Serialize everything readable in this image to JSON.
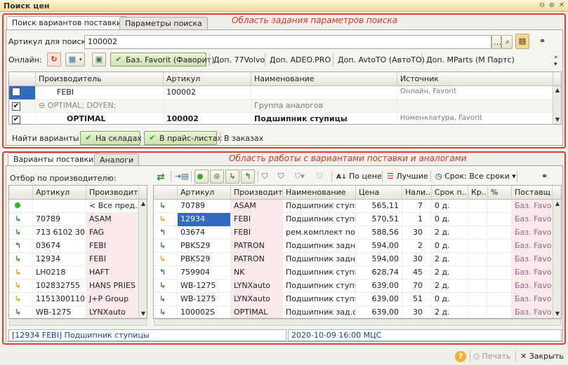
{
  "window": {
    "title": "Поиск цен"
  },
  "top_panel": {
    "label": "Область задания параметров поиска",
    "tabs": [
      "Поиск вариантов поставки",
      "Параметры поиска"
    ],
    "article_label": "Артикул для поиска:",
    "article_value": "100002",
    "online_label": "Онлайн:",
    "sources": [
      "Баз. Favorit (Фаворит)",
      "Доп. 77Volvo",
      "Доп. ADEO.PRO",
      "Доп. AvtoTO (АвтоТО)",
      "Доп. MParts (М Партс)"
    ],
    "grid": {
      "columns": [
        "Производитель",
        "Артикул",
        "Наименование",
        "Источник"
      ],
      "rows": [
        {
          "checked": false,
          "maker": "FEBI",
          "article": "100002",
          "name": "",
          "source": "Онлайн, Favorit"
        },
        {
          "checked": true,
          "maker": "OPTIMAL; DOYEN;",
          "article": "",
          "name": "Группа аналогов",
          "source": ""
        },
        {
          "checked": true,
          "maker": "OPTIMAL",
          "article": "100002",
          "name": "Подшипник ступицы",
          "source": "Номенклатура, Favorit"
        }
      ]
    },
    "find_label": "Найти варианты:",
    "find_buttons": [
      "На складах",
      "В прайс-листах"
    ],
    "orders_link": "В заказах"
  },
  "bottom_panel": {
    "label": "Область работы с вариантами поставки и аналогами",
    "tabs": [
      "Варианты поставки",
      "Аналоги"
    ],
    "filter_label": "Отбор по производителю:",
    "toolbar": {
      "price_sort": "По цене",
      "best": "Лучшие",
      "term": "Срок: Все сроки"
    },
    "left_grid": {
      "columns": [
        "Артикул",
        "Производит..."
      ],
      "rows": [
        {
          "icon": "dot",
          "article": "",
          "maker": "< Все пред..."
        },
        {
          "icon": "green",
          "article": "70789",
          "maker": "ASAM"
        },
        {
          "icon": "green",
          "article": "713 6102 30",
          "maker": "FAG"
        },
        {
          "icon": "green-up",
          "article": "03674",
          "maker": "FEBI"
        },
        {
          "icon": "green",
          "article": "12934",
          "maker": "FEBI"
        },
        {
          "icon": "yellow",
          "article": "LH0218",
          "maker": "HAFT"
        },
        {
          "icon": "yellow",
          "article": "102832755",
          "maker": "HANS PRIES"
        },
        {
          "icon": "yellow",
          "article": "1151300110",
          "maker": "J+P Group"
        },
        {
          "icon": "green",
          "article": "WB-1275",
          "maker": "LYNXauto"
        }
      ]
    },
    "right_grid": {
      "columns": [
        "Артикул",
        "Производит...",
        "Наименование",
        "Цена",
        "Нали...",
        "Срок п...",
        "Кр...",
        "%",
        "Поставщ"
      ],
      "rows": [
        {
          "icon": "green",
          "article": "70789",
          "maker": "ASAM",
          "name": "Подшипник ступи...",
          "price": "565,11",
          "qty": "7",
          "term": "0 д.",
          "supplier": "Баз. Favo"
        },
        {
          "icon": "yellow",
          "article": "12934",
          "maker": "FEBI",
          "name": "Подшипник ступи...",
          "price": "570,51",
          "qty": "1",
          "term": "0 д.",
          "supplier": "Баз. Favo"
        },
        {
          "icon": "green-up",
          "article": "03674",
          "maker": "FEBI",
          "name": "рем.комплект по...",
          "price": "588,56",
          "qty": "30",
          "term": "2 д.",
          "supplier": "Баз. Favo"
        },
        {
          "icon": "green",
          "article": "PBK529",
          "maker": "PATRON",
          "name": "Подшипник задн...",
          "price": "594,00",
          "qty": "2",
          "term": "0 д.",
          "supplier": "Баз. Favo"
        },
        {
          "icon": "yellow",
          "article": "PBK529",
          "maker": "PATRON",
          "name": "Подшипник задн...",
          "price": "594,00",
          "qty": "30",
          "term": "2 д.",
          "supplier": "Баз. Favo"
        },
        {
          "icon": "green-up",
          "article": "759904",
          "maker": "NK",
          "name": "Подшипник ступи...",
          "price": "628,74",
          "qty": "45",
          "term": "2 д.",
          "supplier": "Баз. Favo"
        },
        {
          "icon": "green",
          "article": "WB-1275",
          "maker": "LYNXauto",
          "name": "Подшипник ступи...",
          "price": "639,00",
          "qty": "70",
          "term": "2 д.",
          "supplier": "Баз. Favo"
        },
        {
          "icon": "green",
          "article": "WB-1275",
          "maker": "LYNXauto",
          "name": "Подшипник ступи...",
          "price": "639,00",
          "qty": "51",
          "term": "0 д.",
          "supplier": "Баз. Favo"
        },
        {
          "icon": "green",
          "article": "100002S",
          "maker": "OPTIMAL",
          "name": "Подшипник зад.с...",
          "price": "639,00",
          "qty": "30",
          "term": "2 д.",
          "supplier": "Баз. Favo"
        }
      ]
    },
    "status_left": "[12934 FEBI]  Подшипник ступицы",
    "status_right": "2020-10-09 16:00  МЦС"
  },
  "footer": {
    "print": "Печать",
    "close": "Закрыть"
  }
}
